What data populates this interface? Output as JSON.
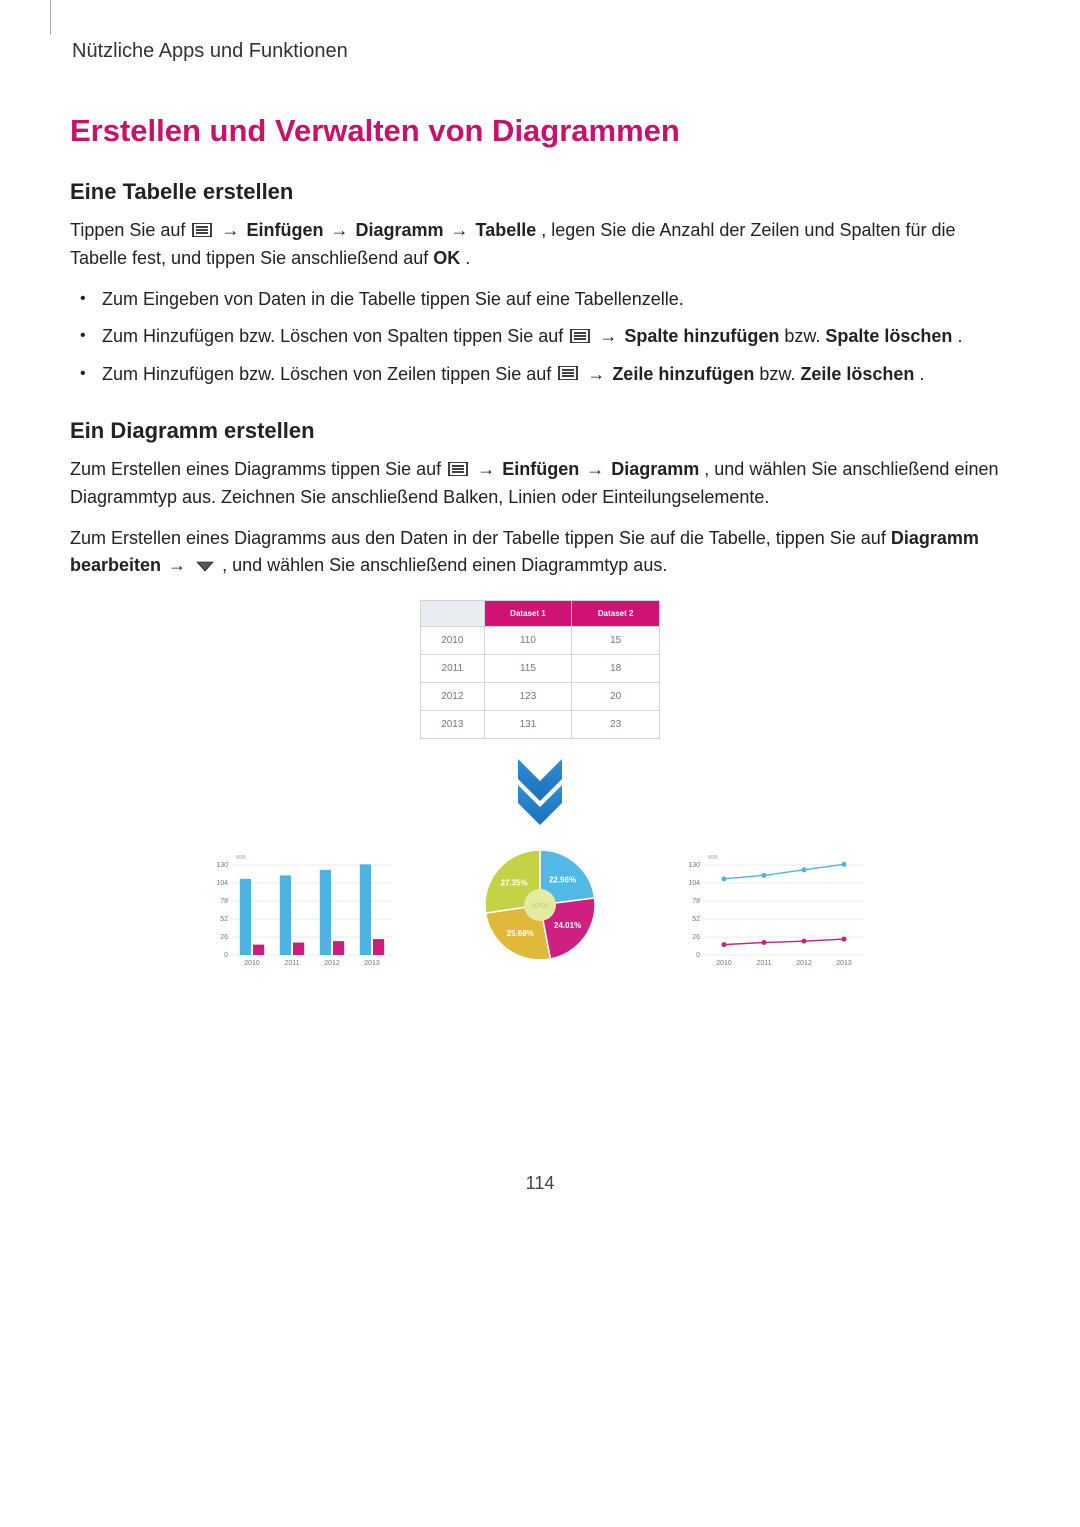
{
  "header": {
    "breadcrumb": "Nützliche Apps und Funktionen"
  },
  "title": "Erstellen und Verwalten von Diagrammen",
  "table_section": {
    "heading": "Eine Tabelle erstellen",
    "p1a": "Tippen Sie auf ",
    "p1b": " → ",
    "p1_einf": "Einfügen",
    "p1c": " → ",
    "p1_diag": "Diagramm",
    "p1d": " → ",
    "p1_tab": "Tabelle",
    "p1e": ", legen Sie die Anzahl der Zeilen und Spalten für die Tabelle fest, und tippen Sie anschließend auf ",
    "p1_ok": "OK",
    "p1f": ".",
    "b1": "Zum Eingeben von Daten in die Tabelle tippen Sie auf eine Tabellenzelle.",
    "b2a": "Zum Hinzufügen bzw. Löschen von Spalten tippen Sie auf ",
    "b2_sp": "Spalte hinzufügen",
    "b2b": " bzw. ",
    "b2_spl": "Spalte löschen",
    "b2c": ".",
    "b3a": "Zum Hinzufügen bzw. Löschen von Zeilen tippen Sie auf ",
    "b3_ze": "Zeile hinzufügen",
    "b3b": " bzw. ",
    "b3_zel": "Zeile löschen",
    "b3c": "."
  },
  "diagram_section": {
    "heading": "Ein Diagramm erstellen",
    "p1a": "Zum Erstellen eines Diagramms tippen Sie auf ",
    "p1b": " → ",
    "p1_einf": "Einfügen",
    "p1c": " → ",
    "p1_diag": "Diagramm",
    "p1d": ", und wählen Sie anschließend einen Diagrammtyp aus. Zeichnen Sie anschließend Balken, Linien oder Einteilungselemente.",
    "p2a": "Zum Erstellen eines Diagramms aus den Daten in der Tabelle tippen Sie auf die Tabelle, tippen Sie auf ",
    "p2_db": "Diagramm bearbeiten",
    "p2b": " → ",
    "p2c": " , und wählen Sie anschließend einen Diagrammtyp aus."
  },
  "table": {
    "headers": [
      "",
      "Dataset 1",
      "Dataset 2"
    ],
    "rows": [
      {
        "year": "2010",
        "d1": "110",
        "d2": "15"
      },
      {
        "year": "2011",
        "d1": "115",
        "d2": "18"
      },
      {
        "year": "2012",
        "d1": "123",
        "d2": "20"
      },
      {
        "year": "2013",
        "d1": "131",
        "d2": "23"
      }
    ]
  },
  "chart_data": [
    {
      "type": "bar",
      "categories": [
        "2010",
        "2011",
        "2012",
        "2013"
      ],
      "series": [
        {
          "name": "Dataset 1",
          "values": [
            110,
            115,
            123,
            131
          ],
          "color": "#4fb2e0"
        },
        {
          "name": "Dataset 2",
          "values": [
            15,
            18,
            20,
            23
          ],
          "color": "#cc1c7f"
        }
      ],
      "y_ticks": [
        0,
        26,
        52,
        78,
        104,
        130
      ],
      "ylim": [
        0,
        130
      ]
    },
    {
      "type": "pie",
      "slices": [
        {
          "label": "22.96%",
          "value": 22.96,
          "color": "#52b8e6"
        },
        {
          "label": "24.01%",
          "value": 24.01,
          "color": "#cf1f80"
        },
        {
          "label": "25.68%",
          "value": 25.68,
          "color": "#e1b93a"
        },
        {
          "label": "27.35%",
          "value": 27.35,
          "color": "#c4d246"
        }
      ],
      "center_label": "00/00"
    },
    {
      "type": "line",
      "categories": [
        "2010",
        "2011",
        "2012",
        "2013"
      ],
      "series": [
        {
          "name": "Dataset 1",
          "values": [
            110,
            115,
            123,
            131
          ],
          "color": "#4fb2e0"
        },
        {
          "name": "Dataset 2",
          "values": [
            15,
            18,
            20,
            23
          ],
          "color": "#cc1c7f"
        }
      ],
      "y_ticks": [
        0,
        26,
        52,
        78,
        104,
        130
      ],
      "ylim": [
        0,
        130
      ]
    }
  ],
  "page_number": "114"
}
